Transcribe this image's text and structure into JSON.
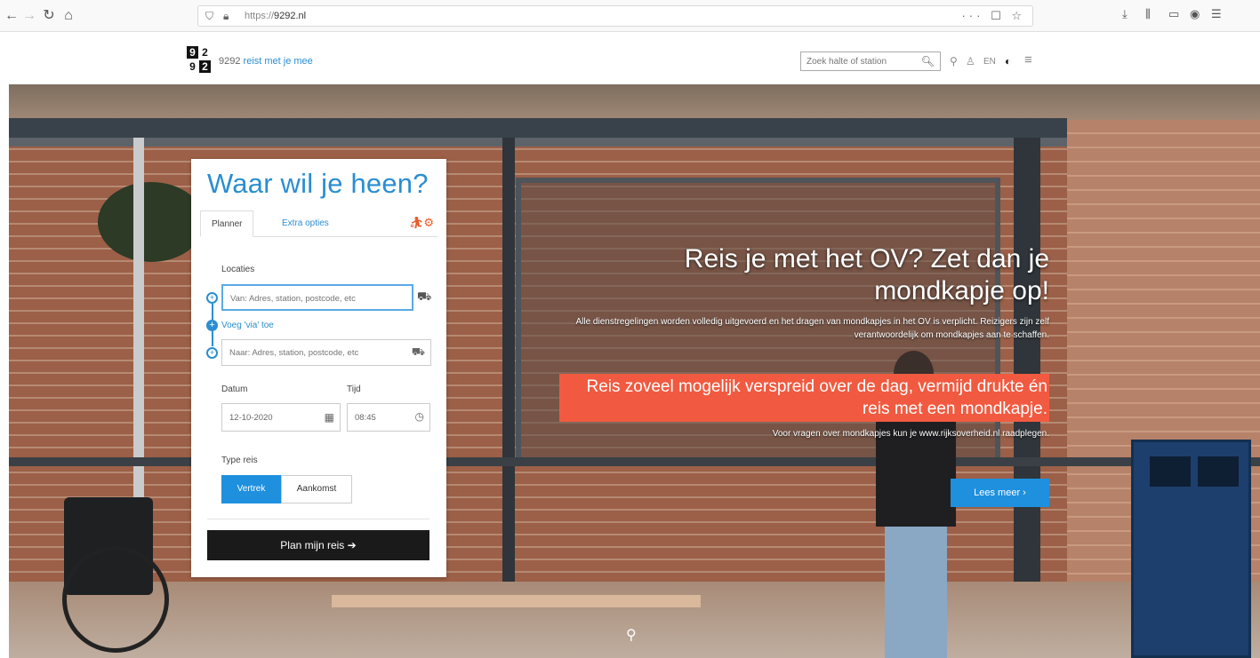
{
  "browser": {
    "url_proto": "https://",
    "url_host": "9292.nl",
    "url_actions": "··· ☐ ☆"
  },
  "header": {
    "logo": [
      "9",
      "2",
      "9",
      "2"
    ],
    "brand": "9292",
    "tagline": "reist met je mee",
    "search_placeholder": "Zoek halte of station",
    "language": "EN"
  },
  "planner": {
    "title": "Waar wil je heen?",
    "tabs": [
      {
        "label": "Planner",
        "active": true
      },
      {
        "label": "Extra opties",
        "active": false
      }
    ],
    "locations_label": "Locaties",
    "from_placeholder": "Van: Adres, station, postcode, etc",
    "add_via_label": "Voeg 'via' toe",
    "to_placeholder": "Naar: Adres, station, postcode, etc",
    "date_label": "Datum",
    "date_value": "12-10-2020",
    "time_label": "Tijd",
    "time_value": "08:45",
    "type_label": "Type reis",
    "type_options": [
      "Vertrek",
      "Aankomst"
    ],
    "plan_button": "Plan mijn reis ➔"
  },
  "hero": {
    "title": "Reis je met het OV? Zet dan je mondkapje op!",
    "body": "Alle dienstregelingen worden volledig uitgevoerd en het dragen van mondkapjes in het OV is verplicht. Reizigers zijn zelf verantwoordelijk om mondkapjes aan te schaffen.",
    "highlight": "Reis zoveel mogelijk verspreid over de dag, vermijd drukte én reis met een mondkapje.",
    "note": "Voor vragen over mondkapjes kun je www.rijksoverheid.nl raadplegen.",
    "more_button": "Lees meer ›"
  },
  "colors": {
    "accent": "#2a8ed1",
    "button_blue": "#1e90de",
    "highlight": "#f15a40",
    "dark_button": "#1a1a1a"
  }
}
